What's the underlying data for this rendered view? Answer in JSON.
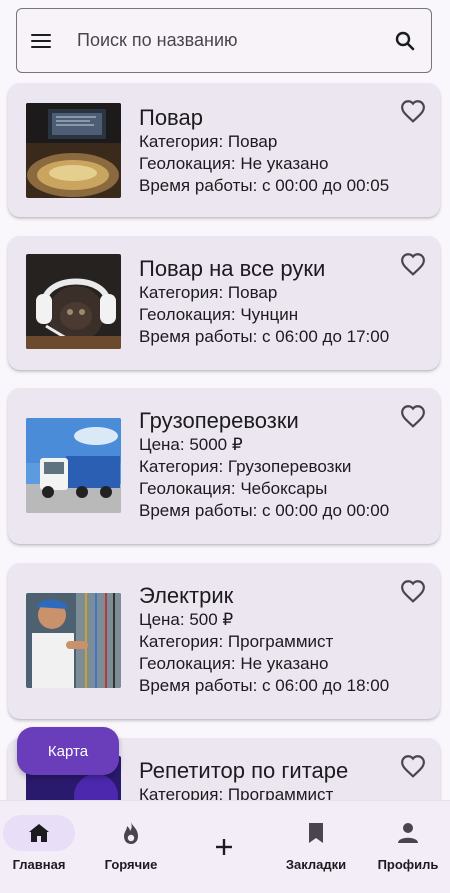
{
  "search": {
    "placeholder": "Поиск по названию"
  },
  "cards": [
    {
      "title": "Повар",
      "lines": [
        "Категория: Повар",
        "Геолокация: Не указано",
        "Время работы: с 00:00 до 00:05"
      ]
    },
    {
      "title": "Повар на все руки",
      "lines": [
        "Категория: Повар",
        "Геолокация: Чунцин",
        "Время работы: с 06:00 до 17:00"
      ]
    },
    {
      "title": "Грузоперевозки",
      "lines": [
        "Цена: 5000 ₽",
        "Категория: Грузоперевозки",
        "Геолокация: Чебоксары",
        "Время работы: с 00:00 до 00:00"
      ]
    },
    {
      "title": "Электрик",
      "lines": [
        "Цена: 500 ₽",
        "Категория: Программист",
        "Геолокация: Не указано",
        "Время работы: с 06:00 до 18:00"
      ]
    },
    {
      "title": "Репетитор по гитаре",
      "lines": [
        "Категория: Программист"
      ]
    }
  ],
  "map_button": "Карта",
  "nav": {
    "home": "Главная",
    "hot": "Горячие",
    "bookmarks": "Закладки",
    "profile": "Профиль"
  },
  "colors": {
    "accent": "#6a3dba",
    "card": "#ece6f0",
    "nav_active": "#e8def8"
  }
}
